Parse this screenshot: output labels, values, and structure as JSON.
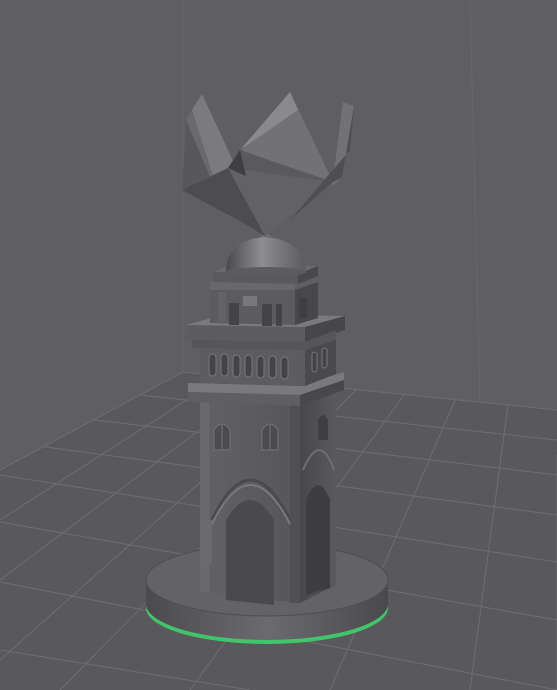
{
  "viewport": {
    "background_color": "#5d5c60",
    "wall_color": "#605f64",
    "floor_color": "#58575b",
    "grid_color": "#6f6e73",
    "model_color": "#5b5b5f",
    "model_light_color": "#8a8a8e",
    "model_dark_color": "#3c3c40",
    "selection_outline_color": "#3fd26b"
  },
  "scene": {
    "model": "tower-with-crown",
    "components": [
      "crown",
      "dome",
      "upper-tower",
      "balcony-with-slots",
      "lower-tower-with-arches",
      "round-base"
    ]
  }
}
